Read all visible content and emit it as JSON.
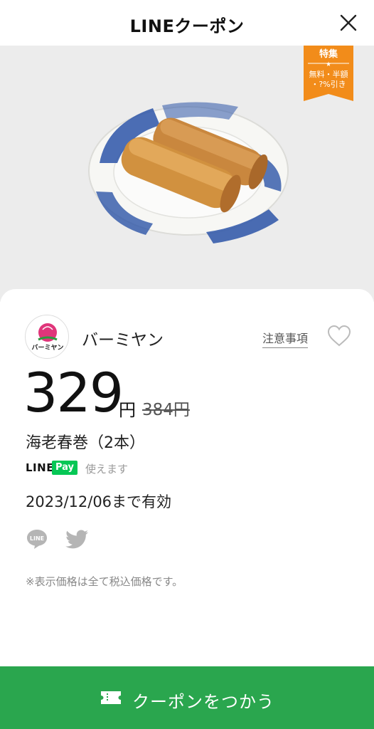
{
  "header": {
    "title": "LINEクーポン",
    "close_icon": "close-icon"
  },
  "ribbon": {
    "line1": "特集",
    "line2": "★",
    "line3": "無料・半額",
    "line4": "・?%引き",
    "color": "#f28c1a"
  },
  "store": {
    "name": "バーミヤン",
    "logo_text": "バーミヤン",
    "notice_label": "注意事項"
  },
  "coupon": {
    "price": "329",
    "price_unit": "円",
    "original_price": "384円",
    "product_name": "海老春巻（2本）",
    "payment_brand_line": "LINE",
    "payment_brand_pay": "Pay",
    "payment_note": "使えます",
    "expiry": "2023/12/06まで有効",
    "tax_note": "※表示価格は全て税込価格です。"
  },
  "share": {
    "line_icon": "line-share-icon",
    "line_label": "LINE",
    "twitter_icon": "twitter-icon"
  },
  "action": {
    "use_label": "クーポンをつかう",
    "color": "#2aa64e"
  }
}
